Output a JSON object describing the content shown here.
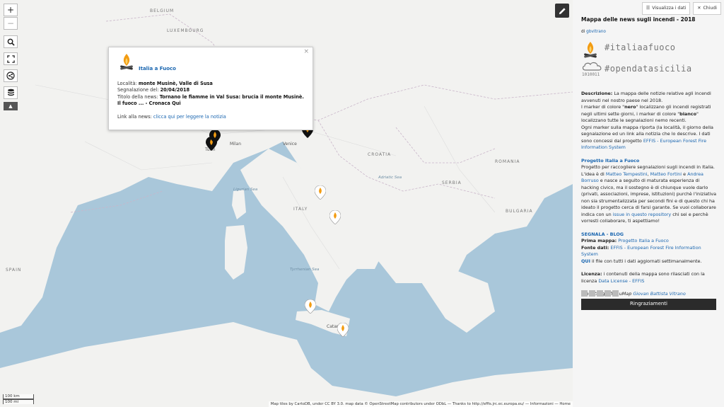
{
  "map": {
    "labels": {
      "belgium": "BELGIUM",
      "luxembourg": "LUXEMBOURG",
      "italy": "ITALY",
      "spain": "SPAIN",
      "romania": "ROMANIA",
      "bulgaria": "BULGARIA",
      "serbia": "SERBIA",
      "croatia": "CROATIA",
      "ligurian": "Ligurian Sea",
      "tyrrhenian": "Tyrrhenian Sea",
      "adriatic": "Adriatic Sea",
      "turin": "Turin",
      "milan": "Milan",
      "venice": "Venice",
      "catania": "Catania"
    },
    "scale": {
      "km": "100 km",
      "mi": "100 mi"
    },
    "attribution": "Map tiles by CartoDB, under CC BY 3.0. map data © OpenStreetMap contributors under ODbL — Thanks to http://effis.jrc.ec.europa.eu/ — Informazioni — Home"
  },
  "controls": {
    "zoom_in": "+",
    "zoom_out": "−",
    "toggle": "▲"
  },
  "popup": {
    "title": "Italia a Fuoco",
    "close": "×",
    "loc_label": "Località:",
    "loc_value": "monte Musinè, Valle di Susa",
    "date_label": "Segnalazione del:",
    "date_value": "20/04/2018",
    "news_label": "Titolo della news:",
    "news_value": "Tornano le fiamme in Val Susa: brucia il monte Musinè. Il fuoco ... - Cronaca Qui",
    "link_label": "Link alla news:",
    "link_text": "clicca qui per leggere la notizia"
  },
  "panel": {
    "btn_data": "Visualizza i dati",
    "btn_close": "Chiudi",
    "title": "Mappa delle news sugli incendi - 2018",
    "by_prefix": "di",
    "author": "gbvitrano",
    "hashtag1": "#italiaafuoco",
    "hashtag2": "#opendatasicilia",
    "desc_label": "Descrizione:",
    "desc_1": "La mappa delle notizie relative agli incendi avvenuti nel nostro paese nel 2018.",
    "desc_2a": "I marker di colore \"",
    "desc_nero": "nero",
    "desc_2b": "\" localizzano gli incendi registrati negli ultimi sette giorni, i marker di colore \"",
    "desc_bianco": "bianco",
    "desc_2c": "\" localizzano tutte le segnalazioni nemo recenti.",
    "desc_3": "Ogni marker sulla mappa riporta (la località, il giorno della segnalazione ed un link alla notizia che lo descrive. I dati sono concessi dal progetto",
    "effis_link": "EFFIS - European Forest Fire Information System",
    "proj_title": "Progetto Italia a Fuoco",
    "proj_1": "Progetto per raccogliere segnalazioni sugli incendi in Italia.",
    "proj_2a": "L'idea è di",
    "tempestini": "Matteo Tempestini",
    "fortini": "Matteo Fortini",
    "and": "e",
    "borruso": "Andrea Borruso",
    "proj_2b": "e nasce a seguito di maturata esperienza di hacking civico, ma il sostegno è di chiunque vuole darlo (privati, associazioni, imprese, istituzioni) purchè l'iniziativa non sia strumentalizzata per secondi fini e di questo chi ha ideato il progetto cerca di farsi garante. Se vuoi collaborare indica con un",
    "issue_link": "issue in questo repository",
    "proj_2c": "chi sei e perchè vorresti collaborare, ti aspettiamo!",
    "segnala": "SEGNALA",
    "dash": " - ",
    "blog": "BLOG",
    "prima_label": "Prima mappa:",
    "prima_link": "Progetto Italia a Fuoco",
    "fonte_label": "Fonte dati:",
    "fonte_link": "EFFIS - European Forest Fire Information System",
    "qui": "QUI",
    "qui_text": "il file con tutti i dati aggiornati settimanalmente.",
    "lic_label": "Licenza:",
    "lic_text": "i contenuti della mappa sono rilasciati con la licenza",
    "lic_link": "Data License - EFFIS",
    "credit_text": "progetto grafico uMap",
    "credit_link": "Giovan Battista Vitrano",
    "thanks": "Ringraziamenti"
  }
}
